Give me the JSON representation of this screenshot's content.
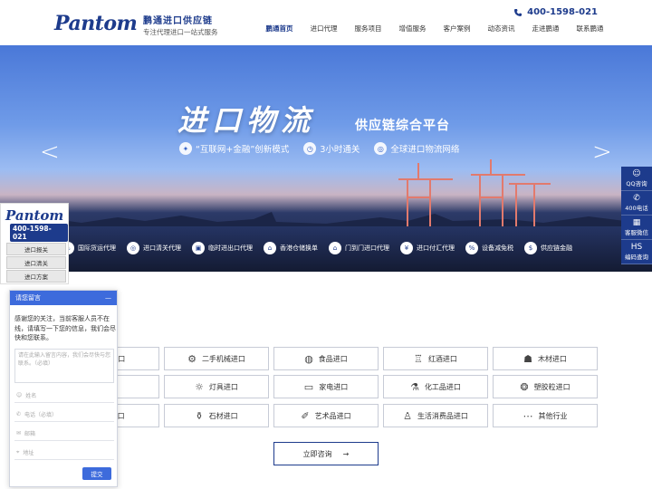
{
  "header": {
    "logo": "Pantom",
    "brand_title": "鹏通进口供应链",
    "brand_sub": "专注代理进口一站式服务",
    "phone": "400-1598-021",
    "nav": [
      "鹏通首页",
      "进口代理",
      "服务项目",
      "增值服务",
      "客户案例",
      "动态资讯",
      "走进鹏通",
      "联系鹏通"
    ]
  },
  "banner": {
    "title": "进口物流",
    "subtitle": "供应链综合平台",
    "features": [
      {
        "label": "“互联网+金融”创新模式",
        "icon": "handshake-icon"
      },
      {
        "label": "3小时通关",
        "icon": "clock-icon"
      },
      {
        "label": "全球进口物流网络",
        "icon": "globe-icon"
      }
    ],
    "arrow_left": "<",
    "arrow_right": ">",
    "services": [
      {
        "label": "国际货运代理",
        "icon": "ship-icon"
      },
      {
        "label": "进口清关代理",
        "icon": "globe-icon"
      },
      {
        "label": "临时进出口代理",
        "icon": "box-icon"
      },
      {
        "label": "香港仓储换单",
        "icon": "warehouse-icon"
      },
      {
        "label": "门到门进口代理",
        "icon": "door-icon"
      },
      {
        "label": "进口付汇代理",
        "icon": "money-icon"
      },
      {
        "label": "设备减免税",
        "icon": "tax-icon"
      },
      {
        "label": "供应链金融",
        "icon": "finance-icon"
      }
    ]
  },
  "right_float": [
    {
      "label": "QQ咨询",
      "icon": "qq-icon"
    },
    {
      "label": "400电话",
      "icon": "phone-icon"
    },
    {
      "label": "客服微信",
      "icon": "qr-icon"
    },
    {
      "label": "编码查询",
      "icon": "hs-icon"
    }
  ],
  "left_float": {
    "logo": "Pantom",
    "phone": "400-1598-021",
    "buttons": [
      "进口报关",
      "进口清关",
      "进口方案"
    ]
  },
  "products": [
    {
      "label": "品进口",
      "icon": "doc-icon"
    },
    {
      "label": "二手机械进口",
      "icon": "machine-icon"
    },
    {
      "label": "食品进口",
      "icon": "food-icon"
    },
    {
      "label": "红酒进口",
      "icon": "wine-icon"
    },
    {
      "label": "木材进口",
      "icon": "wood-icon"
    },
    {
      "label": "口",
      "icon": "box-icon"
    },
    {
      "label": "灯具进口",
      "icon": "lamp-icon"
    },
    {
      "label": "家电进口",
      "icon": "tv-icon"
    },
    {
      "label": "化工品进口",
      "icon": "chemical-icon"
    },
    {
      "label": "塑胶粒进口",
      "icon": "plastic-icon"
    },
    {
      "label": "品进口",
      "icon": "pen-icon"
    },
    {
      "label": "石材进口",
      "icon": "stone-icon"
    },
    {
      "label": "艺术品进口",
      "icon": "art-icon"
    },
    {
      "label": "生活消费品进口",
      "icon": "shirt-icon"
    },
    {
      "label": "其他行业",
      "icon": "more-icon"
    }
  ],
  "consult": {
    "label": "立即咨询",
    "arrow": "→"
  },
  "chat": {
    "title": "请您留言",
    "close": "—",
    "message": "感谢您的关注，当前客服人员不在线，请填写一下您的信息，我们会尽快和您联系。",
    "textarea_placeholder": "请在此输入留言内容，我们会尽快与您联系。（必填）",
    "fields": [
      {
        "placeholder": "姓名",
        "icon": "user-icon"
      },
      {
        "placeholder": "电话（必填）",
        "icon": "phone-icon"
      },
      {
        "placeholder": "邮箱",
        "icon": "mail-icon"
      },
      {
        "placeholder": "地址",
        "icon": "location-icon"
      }
    ],
    "submit": "提交"
  }
}
